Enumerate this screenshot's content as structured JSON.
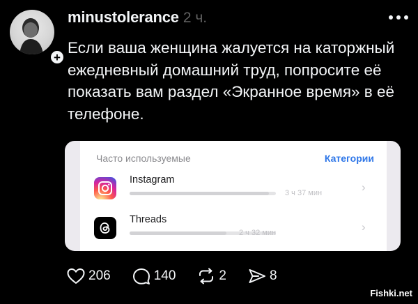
{
  "post": {
    "username": "minustolerance",
    "time": "2 ч.",
    "text": "Если ваша женщина жалуется на каторжный ежедневный домашний труд, попросите её показать вам раздел «Экранное время» в её телефоне.",
    "follow_symbol": "+"
  },
  "screenshot_card": {
    "title": "Часто используемые",
    "link": "Категории",
    "apps": [
      {
        "name": "Instagram",
        "time": "3 ч 37 мин",
        "icon": "instagram-icon",
        "usage_fraction": 0.95
      },
      {
        "name": "Threads",
        "time": "2 ч 32 мин",
        "icon": "threads-icon",
        "usage_fraction": 0.66
      }
    ],
    "chevron": "›"
  },
  "actions": {
    "likes": "206",
    "comments": "140",
    "reposts": "2",
    "shares": "8"
  },
  "watermark": "Fishki.net",
  "colors": {
    "background": "#000000",
    "text": "#f3f5f7",
    "muted": "#616161",
    "link": "#2f77e8"
  }
}
